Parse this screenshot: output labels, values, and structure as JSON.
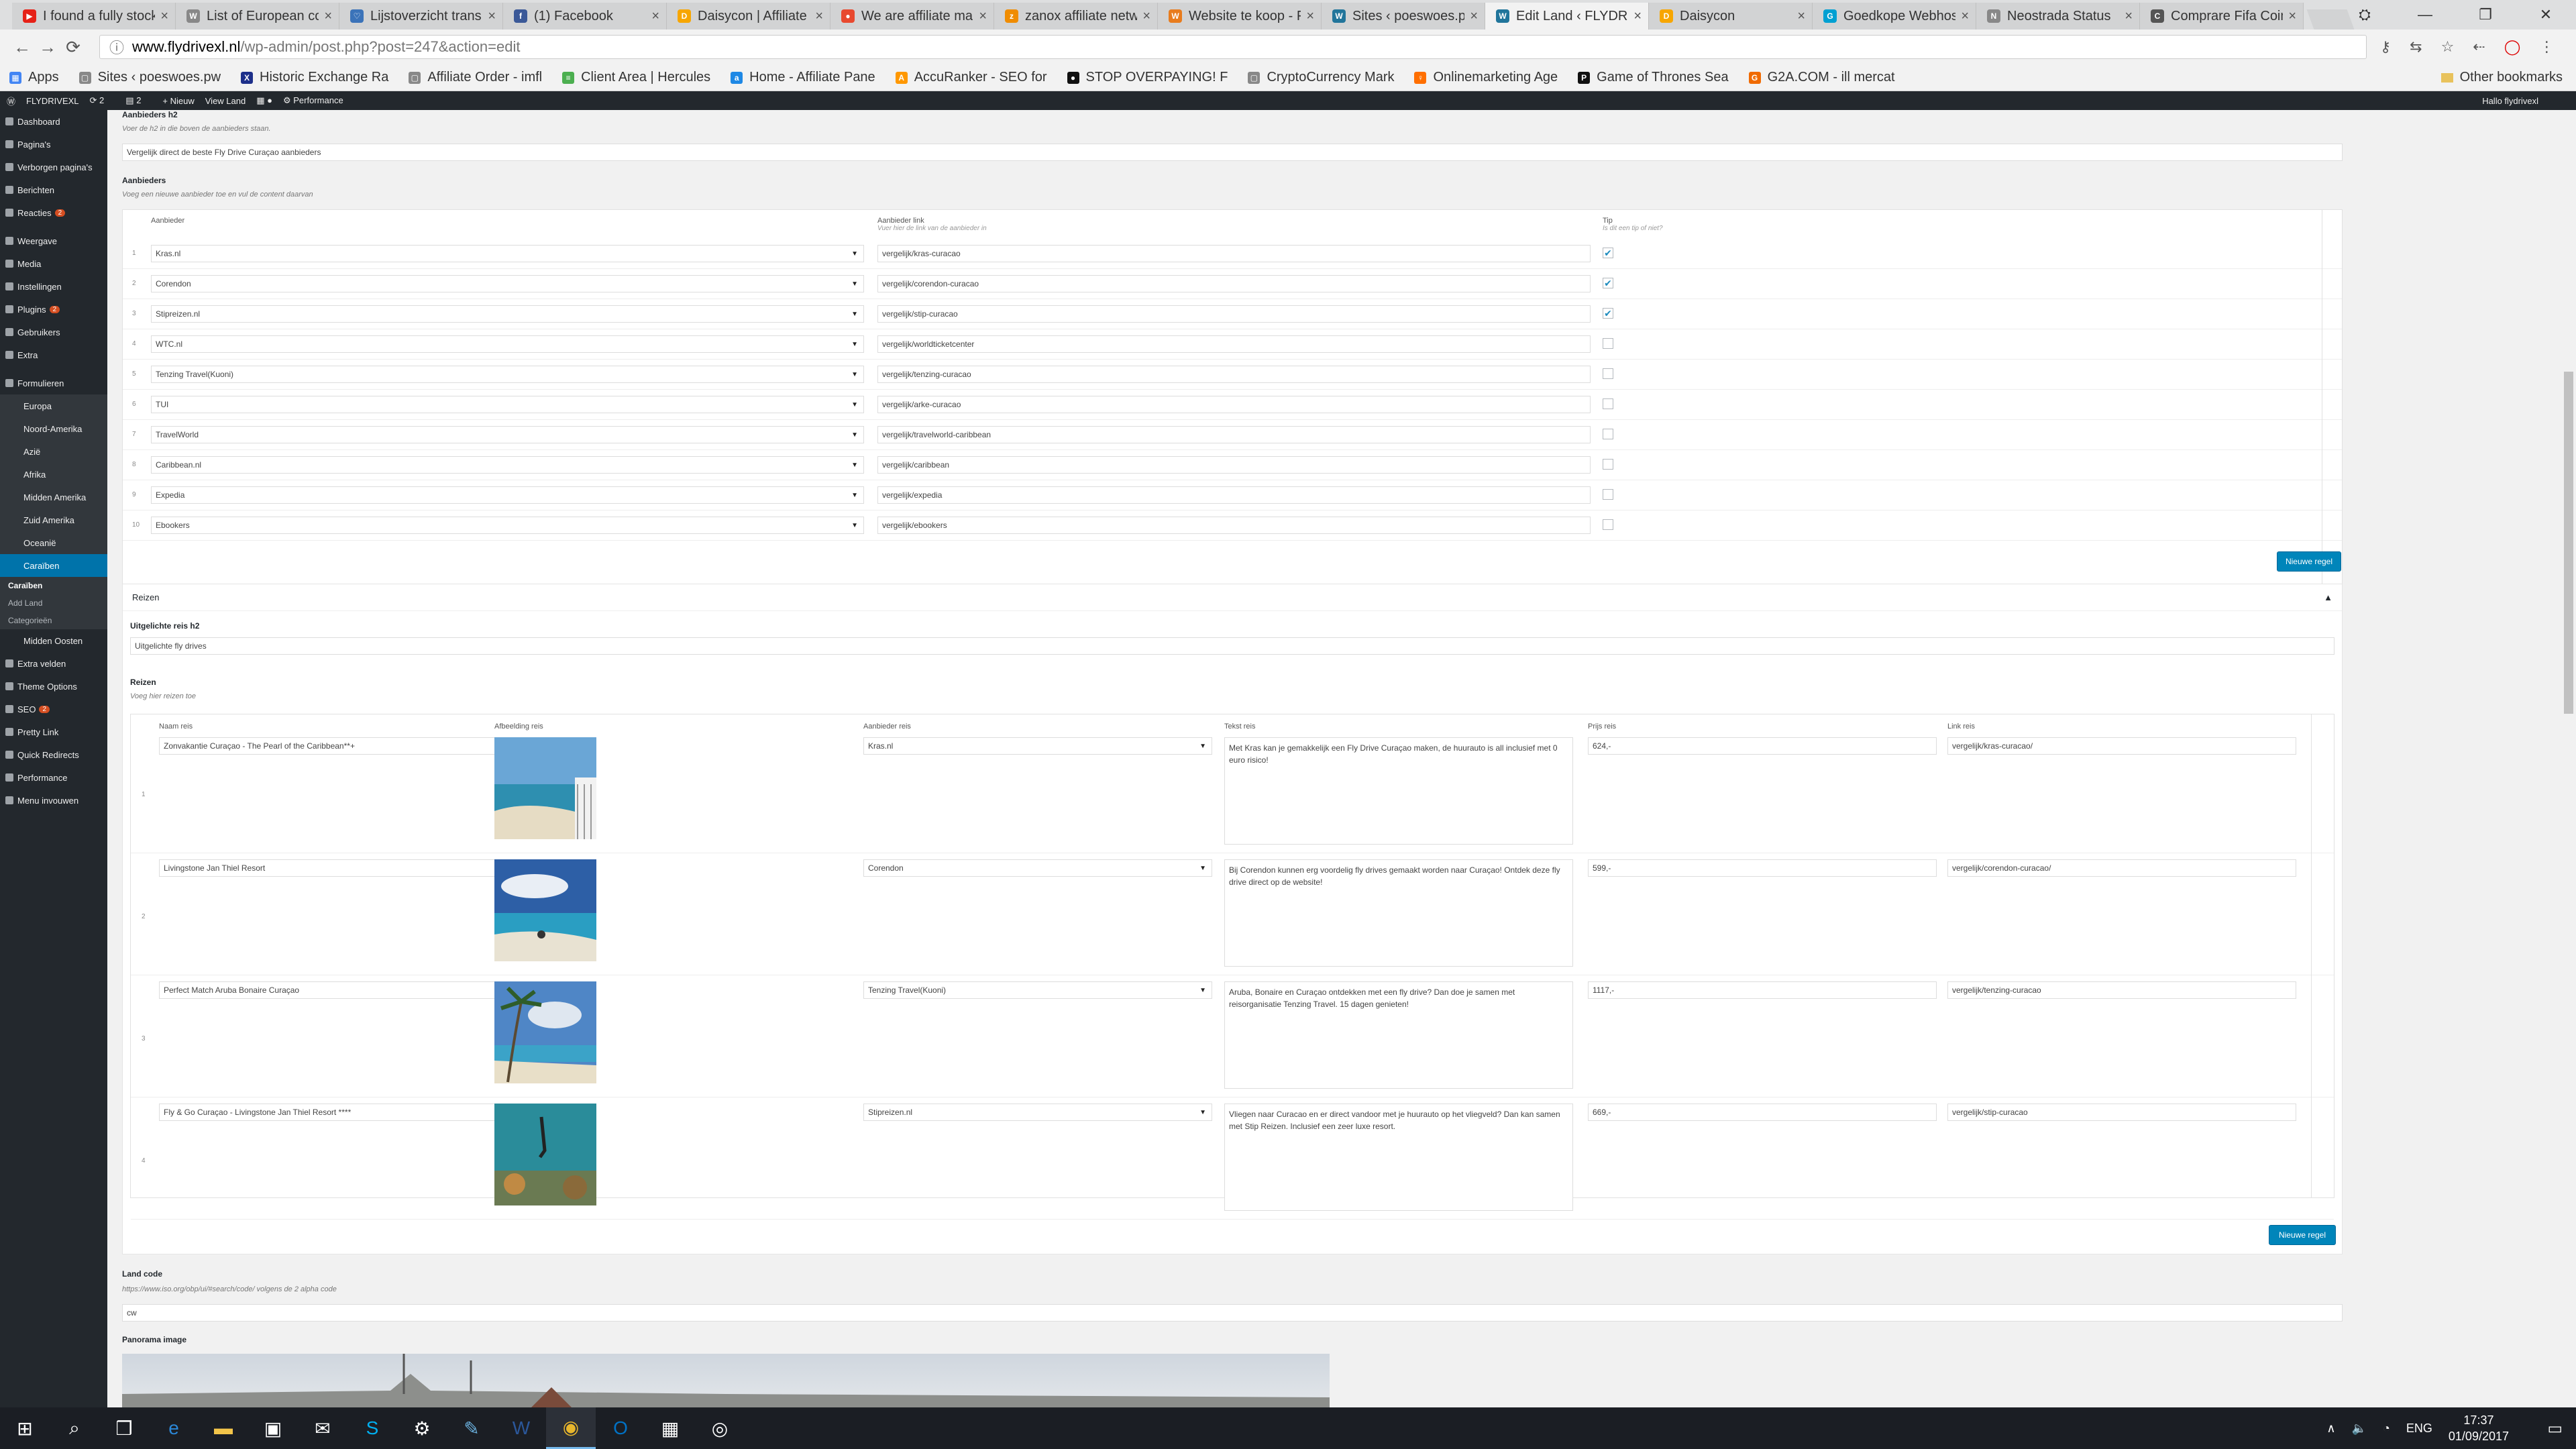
{
  "tabs": [
    {
      "title": "I found a fully stock",
      "color": "#e62117",
      "glyph": "▶"
    },
    {
      "title": "List of European co",
      "color": "#888888",
      "glyph": "W"
    },
    {
      "title": "Lijstoverzicht trans",
      "color": "#3b73b9",
      "glyph": "♡"
    },
    {
      "title": "(1) Facebook",
      "color": "#3b5998",
      "glyph": "f"
    },
    {
      "title": "Daisycon | Affiliate",
      "color": "#f7a600",
      "glyph": "D"
    },
    {
      "title": "We are affiliate ma",
      "color": "#e8492f",
      "glyph": "●"
    },
    {
      "title": "zanox affiliate netw",
      "color": "#f08c00",
      "glyph": "z"
    },
    {
      "title": "Website te koop - F",
      "color": "#e87c1e",
      "glyph": "W"
    },
    {
      "title": "Sites ‹ poeswoes.p",
      "color": "#21759b",
      "glyph": "W"
    },
    {
      "title": "Edit Land ‹ FLYDRIV",
      "color": "#21759b",
      "glyph": "W"
    },
    {
      "title": "Daisycon",
      "color": "#f7a600",
      "glyph": "D"
    },
    {
      "title": "Goedkope Webhos",
      "color": "#00a0d2",
      "glyph": "G"
    },
    {
      "title": "Neostrada Status",
      "color": "#888888",
      "glyph": "N"
    },
    {
      "title": "Comprare Fifa Coin",
      "color": "#555555",
      "glyph": "C"
    }
  ],
  "browser": {
    "url_host": "www.flydrivexl.nl",
    "url_path": "/wp-admin/post.php?post=247&action=edit",
    "other_bookmarks": "Other bookmarks",
    "bookmarks": [
      {
        "label": "Apps",
        "color": "#4285f4",
        "glyph": "▦"
      },
      {
        "label": "Sites ‹ poeswoes.pw",
        "color": "#888888",
        "glyph": "▢"
      },
      {
        "label": "Historic Exchange Ra",
        "color": "#1d2f8a",
        "glyph": "X"
      },
      {
        "label": "Affiliate Order - imfl",
        "color": "#888888",
        "glyph": "▢"
      },
      {
        "label": "Client Area | Hercules",
        "color": "#4caf50",
        "glyph": "≡"
      },
      {
        "label": "Home - Affiliate Pane",
        "color": "#1e88e5",
        "glyph": "a"
      },
      {
        "label": "AccuRanker - SEO for",
        "color": "#ff9800",
        "glyph": "A"
      },
      {
        "label": "STOP OVERPAYING! F",
        "color": "#111111",
        "glyph": "●"
      },
      {
        "label": "CryptoCurrency Mark",
        "color": "#888888",
        "glyph": "▢"
      },
      {
        "label": "Onlinemarketing Age",
        "color": "#ff6f00",
        "glyph": "♀"
      },
      {
        "label": "Game of Thrones Sea",
        "color": "#111111",
        "glyph": "P"
      },
      {
        "label": "G2A.COM - ill mercat",
        "color": "#f06a00",
        "glyph": "G"
      }
    ]
  },
  "adminbar": {
    "site": "FLYDRIVEXL",
    "updates": "2",
    "comments": "2",
    "new": "+ Nieuw",
    "view": "View Land",
    "perf": "Performance",
    "greeting": "Hallo flydrivexl"
  },
  "sidebar": {
    "top": [
      {
        "label": "Dashboard"
      },
      {
        "label": "Pagina's"
      },
      {
        "label": "Verborgen pagina's"
      },
      {
        "label": "Berichten"
      },
      {
        "label": "Reacties",
        "badge": "2"
      },
      {
        "label": "Weergave"
      },
      {
        "label": "Media"
      },
      {
        "label": "Instellingen"
      },
      {
        "label": "Plugins",
        "badge": "2"
      },
      {
        "label": "Gebruikers"
      },
      {
        "label": "Extra"
      },
      {
        "label": "Formulieren"
      }
    ],
    "regions": [
      "Europa",
      "Noord-Amerika",
      "Azië",
      "Afrika",
      "Midden Amerika",
      "Zuid Amerika",
      "Oceanië",
      "Caraïben"
    ],
    "submenu": [
      "Caraïben",
      "Add Land",
      "Categorieën"
    ],
    "bottom": [
      {
        "label": "Midden Oosten",
        "indent": true
      },
      {
        "label": "Extra velden"
      },
      {
        "label": "Theme Options"
      },
      {
        "label": "SEO",
        "badge": "2"
      },
      {
        "label": "Pretty Link"
      },
      {
        "label": "Quick Redirects"
      },
      {
        "label": "Performance"
      },
      {
        "label": "Menu invouwen"
      }
    ]
  },
  "aanbieders_h2": {
    "label": "Aanbieders h2",
    "desc": "Voer de h2 in die boven de aanbieders staan.",
    "value": "Vergelijk direct de beste Fly Drive Curaçao aanbieders"
  },
  "aanbieders": {
    "label": "Aanbieders",
    "desc": "Voeg een nieuwe aanbieder toe en vul de content daarvan",
    "col1": "Aanbieder",
    "col2": "Aanbieder link",
    "col2_desc": "Vuer hier de link van de aanbieder in",
    "col3": "Tip",
    "col3_desc": "Is dit een tip of niet?",
    "rows": [
      {
        "n": "1",
        "name": "Kras.nl",
        "link": "vergelijk/kras-curacao",
        "tip": true
      },
      {
        "n": "2",
        "name": "Corendon",
        "link": "vergelijk/corendon-curacao",
        "tip": true
      },
      {
        "n": "3",
        "name": "Stipreizen.nl",
        "link": "vergelijk/stip-curacao",
        "tip": true
      },
      {
        "n": "4",
        "name": "WTC.nl",
        "link": "vergelijk/worldticketcenter",
        "tip": false
      },
      {
        "n": "5",
        "name": "Tenzing Travel(Kuoni)",
        "link": "vergelijk/tenzing-curacao",
        "tip": false
      },
      {
        "n": "6",
        "name": "TUI",
        "link": "vergelijk/arke-curacao",
        "tip": false
      },
      {
        "n": "7",
        "name": "TravelWorld",
        "link": "vergelijk/travelworld-caribbean",
        "tip": false
      },
      {
        "n": "8",
        "name": "Caribbean.nl",
        "link": "vergelijk/caribbean",
        "tip": false
      },
      {
        "n": "9",
        "name": "Expedia",
        "link": "vergelijk/expedia",
        "tip": false
      },
      {
        "n": "10",
        "name": "Ebookers",
        "link": "vergelijk/ebookers",
        "tip": false
      }
    ],
    "add_button": "Nieuwe regel"
  },
  "reizen_box": {
    "title": "Reizen",
    "h2_label": "Uitgelichte reis h2",
    "h2_value": "Uitgelichte fly drives",
    "label": "Reizen",
    "desc": "Voeg hier reizen toe",
    "cols": [
      "Naam reis",
      "Afbeelding reis",
      "Aanbieder reis",
      "Tekst reis",
      "Prijs reis",
      "Link reis"
    ],
    "rows": [
      {
        "n": "1",
        "name": "Zonvakantie Curaçao - The Pearl of the Caribbean**+",
        "provider": "Kras.nl",
        "text": "Met Kras kan je gemakkelijk een Fly Drive Curaçao maken, de huurauto is all inclusief met 0 euro risico!",
        "price": "624,-",
        "link": "vergelijk/kras-curacao/",
        "img": "beach-balcony-photo"
      },
      {
        "n": "2",
        "name": "Livingstone Jan Thiel Resort",
        "provider": "Corendon",
        "text": "Bij Corendon kunnen erg voordelig fly drives gemaakt worden naar Curaçao! Ontdek deze fly drive direct op de website!",
        "price": "599,-",
        "link": "vergelijk/corendon-curacao/",
        "img": "beach-sky-photo"
      },
      {
        "n": "3",
        "name": "Perfect Match Aruba Bonaire Curaçao",
        "provider": "Tenzing Travel(Kuoni)",
        "text": "Aruba, Bonaire en Curaçao ontdekken met een fly drive? Dan doe je samen met reisorganisatie Tenzing Travel. 15 dagen genieten!",
        "price": "1117,-",
        "link": "vergelijk/tenzing-curacao",
        "img": "palm-beach-photo"
      },
      {
        "n": "4",
        "name": "Fly & Go Curaçao - Livingstone Jan Thiel Resort ****",
        "provider": "Stipreizen.nl",
        "text": "Vliegen naar Curacao en er direct vandoor met je huurauto op het vliegveld? Dan kan samen met Stip Reizen. Inclusief een zeer luxe resort.",
        "price": "669,-",
        "link": "vergelijk/stip-curacao",
        "img": "underwater-diver-photo"
      }
    ],
    "add_button": "Nieuwe regel"
  },
  "land_code": {
    "label": "Land code",
    "desc": "https://www.iso.org/obp/ui/#search/code/ volgens de 2 alpha code",
    "value": "cw"
  },
  "panorama": {
    "label": "Panorama image"
  },
  "taskbar": {
    "lang": "ENG",
    "time": "17:37",
    "date": "01/09/2017"
  }
}
